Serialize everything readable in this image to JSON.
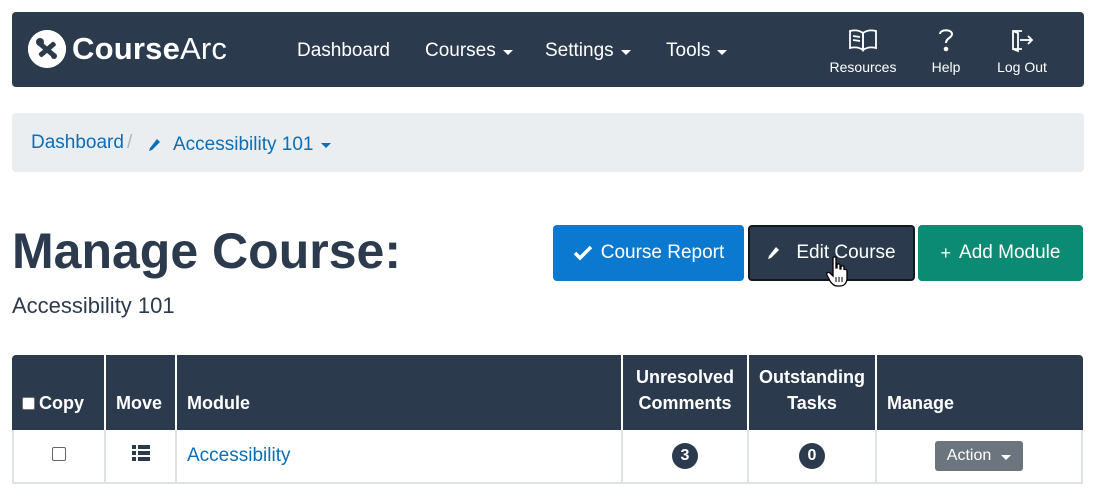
{
  "navbar": {
    "brand_bold": "Course",
    "brand_light": "Arc",
    "menu": [
      {
        "label": "Dashboard",
        "has_caret": false
      },
      {
        "label": "Courses",
        "has_caret": true
      },
      {
        "label": "Settings",
        "has_caret": true
      },
      {
        "label": "Tools",
        "has_caret": true
      }
    ],
    "utilities": [
      {
        "label": "Resources",
        "icon": "book-icon"
      },
      {
        "label": "Help",
        "icon": "question-icon"
      },
      {
        "label": "Log Out",
        "icon": "logout-icon"
      }
    ]
  },
  "breadcrumb": {
    "home": "Dashboard",
    "separator": "/",
    "current": "Accessibility 101"
  },
  "page": {
    "title": "Manage Course:",
    "subtitle": "Accessibility 101"
  },
  "actions": {
    "report": "Course Report",
    "edit": "Edit Course",
    "add": "Add Module"
  },
  "table": {
    "headers": {
      "copy": "Copy",
      "move": "Move",
      "module": "Module",
      "unresolved_1": "Unresolved",
      "unresolved_2": "Comments",
      "outstanding_1": "Outstanding",
      "outstanding_2": "Tasks",
      "manage": "Manage"
    },
    "rows": [
      {
        "module": "Accessibility",
        "unresolved_comments": "3",
        "outstanding_tasks": "0",
        "action_label": "Action"
      }
    ]
  },
  "colors": {
    "navy": "#2c3a4d",
    "primary": "#0a79cf",
    "success": "#0b8a74",
    "link": "#0a6eb8",
    "secondary": "#6c757d"
  }
}
